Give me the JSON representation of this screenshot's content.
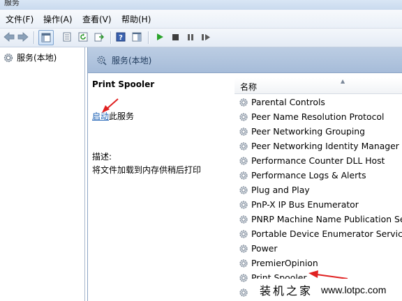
{
  "window": {
    "title": "服务"
  },
  "menu": [
    {
      "label": "文件(F)"
    },
    {
      "label": "操作(A)"
    },
    {
      "label": "查看(V)"
    },
    {
      "label": "帮助(H)"
    }
  ],
  "toolbar": {
    "buttons": [
      "back-icon",
      "forward-icon",
      "show-console-tree-icon",
      "properties-icon",
      "refresh-icon",
      "export-list-icon",
      "help-icon",
      "action-pane-icon",
      "start-service-icon",
      "stop-service-icon",
      "pause-service-icon",
      "restart-service-icon"
    ]
  },
  "tree": {
    "root_label": "服务(本地)"
  },
  "header": {
    "title": "服务(本地)"
  },
  "details": {
    "service_name": "Print Spooler",
    "start_link": "启动",
    "start_suffix": "此服务",
    "description_label": "描述:",
    "description_text": "将文件加载到内存供稍后打印"
  },
  "list": {
    "column_header": "名称",
    "services": [
      "Parental Controls",
      "Peer Name Resolution Protocol",
      "Peer Networking Grouping",
      "Peer Networking Identity Manager",
      "Performance Counter DLL Host",
      "Performance Logs & Alerts",
      "Plug and Play",
      "PnP-X IP Bus Enumerator",
      "PNRP Machine Name Publication Service",
      "Portable Device Enumerator Service",
      "Power",
      "PremierOpinion",
      "Print Spooler",
      "P"
    ]
  },
  "watermark": {
    "text_cn": "装机之家",
    "url": "www.lotpc.com"
  },
  "colors": {
    "annotation_arrow": "#e02020",
    "link": "#1a5fb4",
    "play_green": "#2aa32a"
  }
}
